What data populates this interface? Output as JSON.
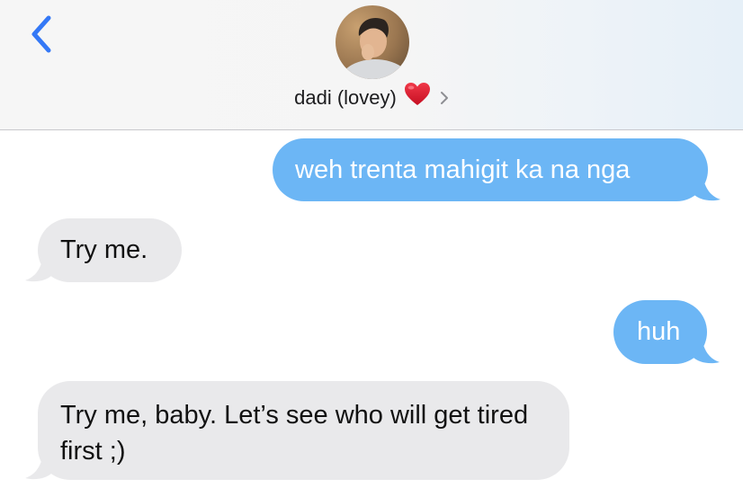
{
  "header": {
    "contact_name": "dadi (lovey)",
    "contact_emoji": "heart-emoji",
    "back_icon": "chevron-left-icon",
    "details_icon": "chevron-right-icon",
    "accent_color": "#3478f6"
  },
  "messages": [
    {
      "direction": "sent",
      "text": "weh trenta mahigit ka na nga"
    },
    {
      "direction": "received",
      "text": "Try me."
    },
    {
      "direction": "sent",
      "text": "huh"
    },
    {
      "direction": "received",
      "text": "Try me, baby. Let’s see who will get tired first ;)"
    }
  ],
  "colors": {
    "sent_bubble": "#6cb6f5",
    "received_bubble": "#e9e9eb",
    "heart": "#e3142e"
  }
}
